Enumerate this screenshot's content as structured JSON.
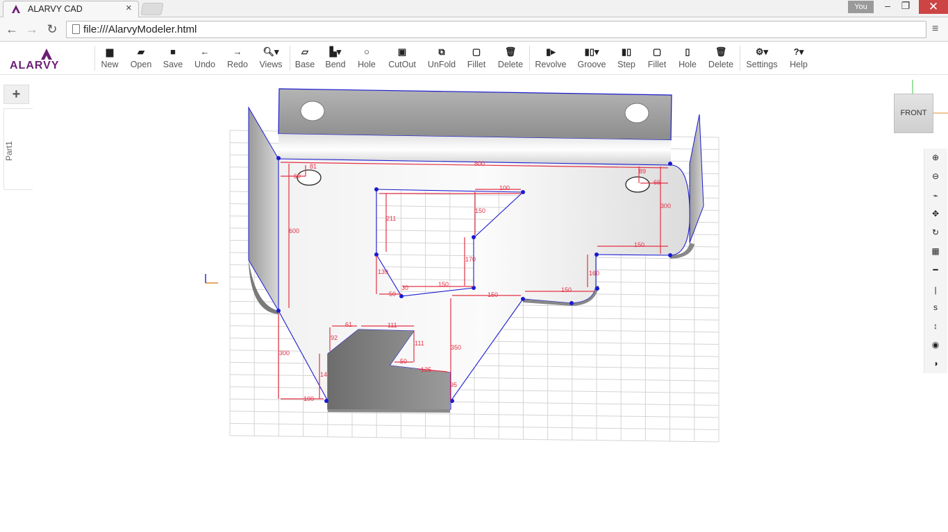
{
  "browser": {
    "tab_title": "ALARVY CAD",
    "tab_close": "×",
    "profile": "You",
    "url": "file:///AlarvyModeler.html",
    "win_min": "–",
    "win_restore": "❐",
    "win_close": "✕",
    "nav_back": "←",
    "nav_forward": "→",
    "nav_reload": "↻",
    "menu": "≡"
  },
  "app": {
    "logo_text": "ALARVY",
    "brand_color": "#6b1f74",
    "tools": [
      {
        "label": "New",
        "icon": "file-icon",
        "glyph": "▆"
      },
      {
        "label": "Open",
        "icon": "folder-open-icon",
        "glyph": "▰"
      },
      {
        "label": "Save",
        "icon": "floppy-icon",
        "glyph": "■"
      },
      {
        "label": "Undo",
        "icon": "arrow-left-icon",
        "glyph": "←"
      },
      {
        "label": "Redo",
        "icon": "arrow-right-icon",
        "glyph": "→"
      },
      {
        "label": "Views",
        "icon": "search-dropdown-icon",
        "glyph": "🔍︎▾"
      },
      {
        "label": "Base",
        "icon": "base-flange-icon",
        "glyph": "▱"
      },
      {
        "label": "Bend",
        "icon": "bend-dropdown-icon",
        "glyph": "▙▾"
      },
      {
        "label": "Hole",
        "icon": "circle-icon",
        "glyph": "○"
      },
      {
        "label": "CutOut",
        "icon": "cutout-icon",
        "glyph": "▣"
      },
      {
        "label": "UnFold",
        "icon": "unfold-icon",
        "glyph": "⧉"
      },
      {
        "label": "Fillet",
        "icon": "fillet-icon",
        "glyph": "▢"
      },
      {
        "label": "Delete",
        "icon": "trash-icon",
        "glyph": "🗑︎"
      },
      {
        "label": "Revolve",
        "icon": "revolve-icon",
        "glyph": "▮▸"
      },
      {
        "label": "Groove",
        "icon": "groove-dropdown-icon",
        "glyph": "▮▯▾"
      },
      {
        "label": "Step",
        "icon": "step-icon",
        "glyph": "▮▯"
      },
      {
        "label": "Fillet",
        "icon": "fillet-solid-icon",
        "glyph": "▢"
      },
      {
        "label": "Hole",
        "icon": "hole-solid-icon",
        "glyph": "▯"
      },
      {
        "label": "Delete",
        "icon": "trash-icon",
        "glyph": "🗑︎"
      },
      {
        "label": "Settings",
        "icon": "gear-dropdown-icon",
        "glyph": "⚙▾"
      },
      {
        "label": "Help",
        "icon": "help-dropdown-icon",
        "glyph": "?▾"
      }
    ]
  },
  "left_panel": {
    "add_button": "+",
    "part_tab": "Part1"
  },
  "view_cube": {
    "face": "FRONT"
  },
  "right_tools": [
    {
      "icon": "zoom-in-icon",
      "glyph": "⊕"
    },
    {
      "icon": "zoom-out-icon",
      "glyph": "⊖"
    },
    {
      "icon": "mouse-zoom-icon",
      "glyph": "⌁"
    },
    {
      "icon": "pan-icon",
      "glyph": "✥"
    },
    {
      "icon": "rotate-icon",
      "glyph": "↻"
    },
    {
      "icon": "grid-icon",
      "glyph": "▦"
    },
    {
      "icon": "horizontal-line-icon",
      "glyph": "━"
    },
    {
      "icon": "vertical-line-icon",
      "glyph": "|"
    },
    {
      "icon": "s-icon",
      "glyph": "s"
    },
    {
      "icon": "vertical-arrows-icon",
      "glyph": "↕"
    },
    {
      "icon": "eye-icon",
      "glyph": "◉"
    },
    {
      "icon": "contrast-icon",
      "glyph": "◑"
    }
  ],
  "dimensions": {
    "d800": "800",
    "d81": "81",
    "d89": "89",
    "d66": "66",
    "d100a": "100",
    "d150a": "150",
    "d211": "211",
    "d600": "600",
    "d300a": "300",
    "d150b": "150",
    "d170": "170",
    "d139": "139",
    "d50a": "50",
    "d30": "30",
    "d150c": "150",
    "d150d": "150",
    "d160": "160",
    "d150e": "150",
    "d61": "61",
    "d111a": "111",
    "d111b": "111",
    "d92": "92",
    "d50b": "50",
    "d125": "125",
    "d350": "350",
    "d300b": "300",
    "d14": "14",
    "d100b": "100",
    "d95": "95",
    "d60": "60"
  }
}
